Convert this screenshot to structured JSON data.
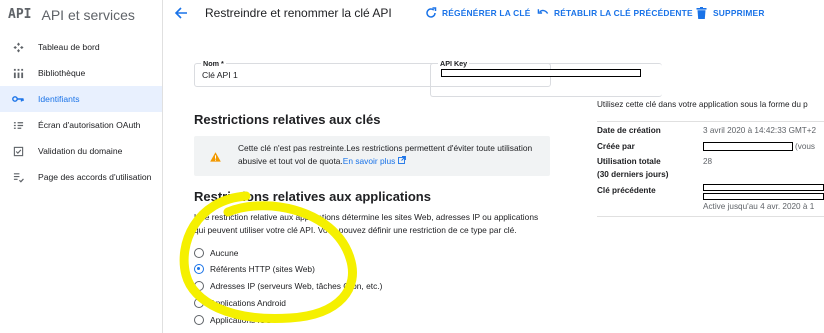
{
  "sidebar": {
    "logo": "API",
    "title": "API et services",
    "items": [
      {
        "label": "Tableau de bord",
        "icon": "dashboard-icon",
        "active": false
      },
      {
        "label": "Bibliothèque",
        "icon": "library-icon",
        "active": false
      },
      {
        "label": "Identifiants",
        "icon": "key-icon",
        "active": true
      },
      {
        "label": "Écran d'autorisation OAuth",
        "icon": "consent-icon",
        "active": false
      },
      {
        "label": "Validation du domaine",
        "icon": "domain-check-icon",
        "active": false
      },
      {
        "label": "Page des accords d'utilisation",
        "icon": "agreements-icon",
        "active": false
      }
    ]
  },
  "header": {
    "title": "Restreindre et renommer la clé API",
    "regenerate_label": "RÉGÉNÉRER LA CLÉ",
    "restore_label": "RÉTABLIR LA CLÉ PRÉCÉDENTE",
    "delete_label": "SUPPRIMER"
  },
  "form": {
    "name_label": "Nom *",
    "name_value": "Clé API 1",
    "key_restrictions_heading": "Restrictions relatives aux clés",
    "notice_text": "Cette clé n'est pas restreinte.Les restrictions permettent d'éviter toute utilisation abusive et tout vol de quota.",
    "notice_link": "En savoir plus",
    "app_restrictions_heading": "Restrictions relatives aux applications",
    "app_restrictions_text": "Une restriction relative aux applications détermine les sites Web, adresses IP ou applications qui peuvent utiliser votre clé API. Vous pouvez définir une restriction de ce type par clé.",
    "options": [
      {
        "label": "Aucune",
        "checked": false
      },
      {
        "label": "Référents HTTP (sites Web)",
        "checked": true
      },
      {
        "label": "Adresses IP (serveurs Web, tâches Cron, etc.)",
        "checked": false
      },
      {
        "label": "Applications Android",
        "checked": false
      },
      {
        "label": "Applications iOS",
        "checked": false
      }
    ]
  },
  "key_panel": {
    "key_label": "API Key",
    "usage_text": "Utilisez cette clé dans votre application sous la forme du p",
    "created_label": "Date de création",
    "created_value": "3 avril 2020 à 14:42:33 GMT+2",
    "created_by_label": "Créée par",
    "created_by_suffix": "(vous",
    "total_usage_label": "Utilisation totale",
    "total_usage_sub": "(30 derniers jours)",
    "total_usage_value": "28",
    "previous_key_label": "Clé précédente",
    "previous_key_note": "Active jusqu'au 4 avr. 2020 à 1"
  },
  "colors": {
    "accent": "#1a73e8",
    "warning": "#f29900",
    "annotation": "#f5f000"
  }
}
